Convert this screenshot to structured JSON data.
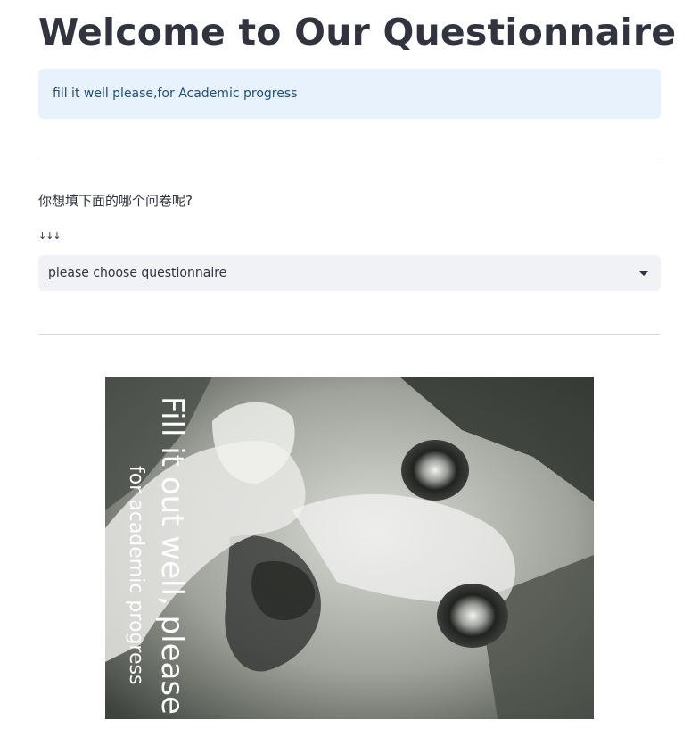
{
  "header": {
    "title": "Welcome to Our Questionnaire"
  },
  "info_box": {
    "text": "fill it well please,for Academic progress"
  },
  "form": {
    "question": "你想填下面的哪个问卷呢?",
    "arrows": "↓↓↓",
    "select": {
      "selected": "please choose questionnaire",
      "icon": "chevron-down-icon"
    }
  },
  "meme_image": {
    "caption_main": "Fill it out well, please",
    "caption_sub": "for academic progress"
  }
}
